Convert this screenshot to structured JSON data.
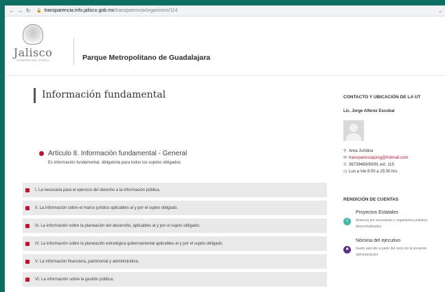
{
  "browser": {
    "url_host": "transparencia.info.jalisco.gob.mx",
    "url_path": "/transparencia/organismo/114"
  },
  "header": {
    "logo_text": "Jalisco",
    "logo_subtext": "GOBIERNO DEL ESTADO",
    "site_title": "Parque Metropolitano de Guadalajara"
  },
  "main": {
    "section_title": "Información fundamental",
    "article": {
      "title": "Artículo 8. Información fundamental - General",
      "description": "Es información fundamental, obligatoria para todos los sujetos obligados."
    },
    "items": [
      "I. La necesaria para el ejercicio del derecho a la información pública.",
      "II. La información sobre el marco jurídico aplicables al y por el sujeto obligado.",
      "III. La información sobre la planeación del desarrollo, aplicables al y por el sujeto obligado.",
      "IV. La información sobre la planeación estratégica gubernamental aplicables al y por el sujeto obligado.",
      "V. La información financiera, patrimonial y administrativa.",
      "VI. La información sobre la gestión pública."
    ]
  },
  "sidebar": {
    "contact_heading": "CONTACTO Y UBICACIÓN DE LA UT",
    "contact_name": "Lic. Jorge Alferez Escobar",
    "area": "Area Jurídica",
    "email": "transparenciapmg@hotmail.com",
    "phone": "36739489/90/91 ext. 115",
    "hours": "Lun a Vie 8:00 a 15:00 hrs.",
    "accounts_heading": "RENDICIÓN DE CUENTAS",
    "accounts": [
      {
        "title": "Proyectos Estatales",
        "description": "Avances por secretarías y organismos públicos descentralizados",
        "color": "#3fb9a6",
        "icon": "chart-icon"
      },
      {
        "title": "Nómina del ejecutivo",
        "description": "Gasto ejercido a partir del inicio de la presente administración",
        "color": "#5b2d90",
        "icon": "payroll-icon"
      }
    ]
  },
  "colors": {
    "accent": "#c8102e",
    "background": "#0f6e62"
  }
}
